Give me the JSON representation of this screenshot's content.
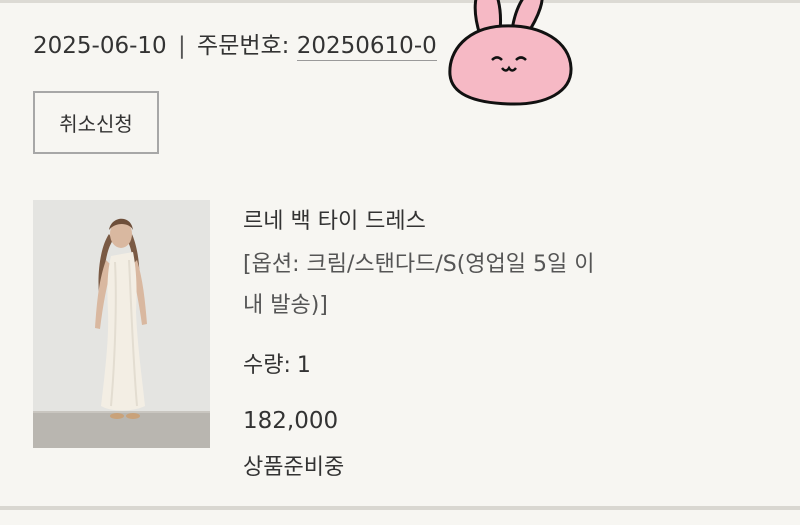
{
  "order": {
    "date": "2025-06-10",
    "separator": "|",
    "number_label": "주문번호:",
    "number_value": "20250610-0"
  },
  "actions": {
    "cancel_label": "취소신청"
  },
  "product": {
    "name": "르네 백 타이 드레스",
    "option": "[옵션: 크림/스탠다드/S(영업일 5일 이내 발송)]",
    "quantity_label": "수량:",
    "quantity_value": "1",
    "price": "182,000",
    "status": "상품준비중"
  },
  "colors": {
    "background": "#f7f6f2",
    "text": "#333333",
    "button_border": "#a7a7a7",
    "sticker_pink": "#f6b9c5"
  }
}
